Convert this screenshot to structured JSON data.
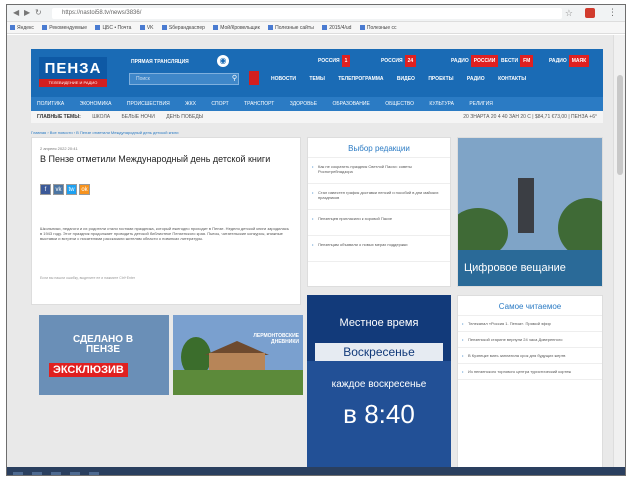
{
  "browser": {
    "url": "https://nastoi58.tv/news/3836/",
    "bookmarks": [
      "Яндекс",
      "Рекомендуемые",
      "ЦБС • Почта",
      "VK",
      "Sберандкаспер",
      "Мой/Кровельщик",
      "Полезные сайты",
      "2015/4/ud",
      "Полезные сс"
    ]
  },
  "site": {
    "logo": "ПЕНЗА",
    "logo_sub": "ТЕЛЕВИДЕНИЕ И РАДИО",
    "live": "ПРЯМАЯ ТРАНСЛЯЦИЯ",
    "search_placeholder": "Поиск",
    "channels": [
      {
        "name": "РОССИЯ",
        "badge": "1"
      },
      {
        "name": "РОССИЯ",
        "badge": "24"
      },
      {
        "name": "РАДИО",
        "badge": "РОССИИ"
      },
      {
        "name": "ВЕСТИ",
        "badge": "FM"
      },
      {
        "name": "РАДИО",
        "badge": "МАЯК"
      }
    ],
    "top_menu": [
      "НОВОСТИ",
      "ТЕМЫ",
      "ТЕЛЕПРОГРАММА",
      "ВИДЕО",
      "ПРОЕКТЫ",
      "РАДИО",
      "КОНТАКТЫ"
    ],
    "main_nav": [
      "ПОЛИТИКА",
      "ЭКОНОМИКА",
      "ПРОИСШЕСТВИЯ",
      "ЖКХ",
      "СПОРТ",
      "ТРАНСПОРТ",
      "ЗДОРОВЬЕ",
      "ОБРАЗОВАНИЕ",
      "ОБЩЕСТВО",
      "КУЛЬТУРА",
      "РЕЛИГИЯ"
    ],
    "main_topics_label": "ГЛАВНЫЕ ТЕМЫ:",
    "main_topics": [
      "ШКОЛА",
      "БЕЛЫЕ НОЧИ",
      "ДЕНЬ ПОБЕДЫ"
    ],
    "subbar_right": "20 ЗНАРТА 20 4 40 ЗАН 20 С | $84,71 €73,00 | ПЕНЗА +6°",
    "breadcrumb": "Главная › Все новости › В Пензе отметили Международный день детской книги"
  },
  "article": {
    "date": "2 апреля 2022 20:41",
    "title": "В Пензе отметили Международный день детской книги",
    "share": [
      "f",
      "vk",
      "tw",
      "ok"
    ],
    "body": "Школьники, педагоги и их родители стали гостями праздника, который ежегодно проходит в Пензе. Неделя детской книги зародилась в 1943 году. Этот праздник продолжает проводить детской библиотеке Пензенского края. Пьесы, читательские конкурсы, книжные выставки и встречи с писателями рассказали жителям области о новинках литературы.",
    "footer": "Если вы нашли ошибку, выделите ее и нажмите Ctrl+Enter"
  },
  "editor_choice": {
    "title": "Выбор редакции",
    "items": [
      "Как не сократить праздник Светлой Пасхи: советы Роспотребнадзора",
      "Стал известен график доставки пенсий и пособий в дни майских праздников",
      "Пензенцев пригласили к хоровой Пасхе",
      "Пензенцам объявили о новых мерах поддержки"
    ]
  },
  "photo_banner": "Цифровое вещание",
  "promo1": {
    "line1": "СДЕЛАНО В ПЕНЗЕ",
    "line2": "ЭКСКЛЮЗИВ"
  },
  "promo2": {
    "label": "ЛЕРМОНТОВСКИЕ ДНЕВНИКИ"
  },
  "time_card": {
    "line1": "Местное время",
    "line2": "Воскресенье",
    "line3": "каждое воскресенье",
    "line4": "в 8:40"
  },
  "popular": {
    "title": "Самое читаемое",
    "items": [
      "Телеканал «Россия 1. Пенза». Прямой эфир",
      "Пензенской старине вернули 24 часа Доверенного",
      "В Кузнецке мать заплатила срок для будущих жертв",
      "Из пензенского торгового центра туристический кортеж"
    ]
  }
}
